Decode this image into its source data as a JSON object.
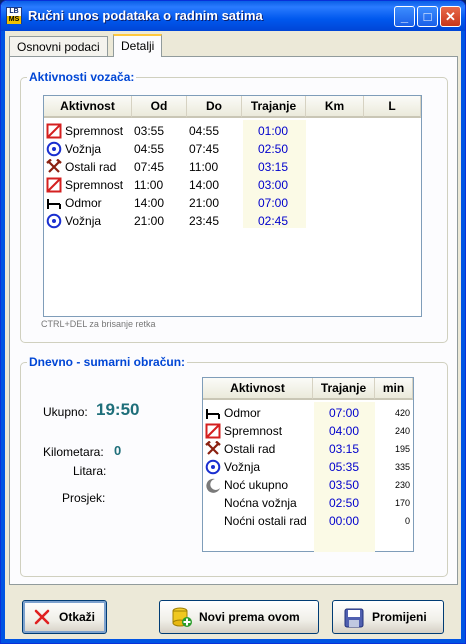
{
  "window": {
    "title": "Ručni unos podataka o radnim satima",
    "icon_text_top": "LB",
    "icon_text_bottom": "MS"
  },
  "title_buttons": {
    "minimize": "_",
    "maximize": "□",
    "close": "✕"
  },
  "tabs": [
    {
      "label": "Osnovni podaci",
      "active": false
    },
    {
      "label": "Detalji",
      "active": true
    }
  ],
  "activities_group": {
    "title": "Aktivnosti vozača:",
    "headers": [
      "Aktivnost",
      "Od",
      "Do",
      "Trajanje",
      "Km",
      "L"
    ],
    "rows": [
      {
        "icon": "spremnost-icon",
        "activity": "Spremnost",
        "from": "03:55",
        "to": "04:55",
        "duration": "01:00",
        "km": "",
        "l": ""
      },
      {
        "icon": "voznja-icon",
        "activity": "Vožnja",
        "from": "04:55",
        "to": "07:45",
        "duration": "02:50",
        "km": "",
        "l": ""
      },
      {
        "icon": "ostali-rad-icon",
        "activity": "Ostali rad",
        "from": "07:45",
        "to": "11:00",
        "duration": "03:15",
        "km": "",
        "l": ""
      },
      {
        "icon": "spremnost-icon",
        "activity": "Spremnost",
        "from": "11:00",
        "to": "14:00",
        "duration": "03:00",
        "km": "",
        "l": ""
      },
      {
        "icon": "odmor-icon",
        "activity": "Odmor",
        "from": "14:00",
        "to": "21:00",
        "duration": "07:00",
        "km": "",
        "l": ""
      },
      {
        "icon": "voznja-icon",
        "activity": "Vožnja",
        "from": "21:00",
        "to": "23:45",
        "duration": "02:45",
        "km": "",
        "l": ""
      }
    ],
    "hint": "CTRL+DEL za brisanje retka"
  },
  "summary_group": {
    "title": "Dnevno - sumarni obračun:",
    "ukupno_label": "Ukupno:",
    "ukupno_value": "19:50",
    "kilometara_label": "Kilometara:",
    "kilometara_value": "0",
    "litara_label": "Litara:",
    "prosjek_label": "Prosjek:",
    "headers": [
      "Aktivnost",
      "Trajanje",
      "min"
    ],
    "rows": [
      {
        "icon": "odmor-icon",
        "activity": "Odmor",
        "duration": "07:00",
        "min": "420"
      },
      {
        "icon": "spremnost-icon",
        "activity": "Spremnost",
        "duration": "04:00",
        "min": "240"
      },
      {
        "icon": "ostali-rad-icon",
        "activity": "Ostali rad",
        "duration": "03:15",
        "min": "195"
      },
      {
        "icon": "voznja-icon",
        "activity": "Vožnja",
        "duration": "05:35",
        "min": "335"
      },
      {
        "icon": "noc-icon",
        "activity": "Noć ukupno",
        "duration": "03:50",
        "min": "230"
      },
      {
        "icon": "",
        "activity": "Noćna vožnja",
        "duration": "02:50",
        "min": "170"
      },
      {
        "icon": "",
        "activity": "Noćni ostali rad",
        "duration": "00:00",
        "min": "0"
      }
    ]
  },
  "buttons": {
    "cancel": "Otkaži",
    "new_from": "Novi prema ovom",
    "save": "Promijeni"
  },
  "colors": {
    "accent_blue": "#0046d5",
    "value_teal": "#1f6f7a",
    "icon_red": "#d42020",
    "icon_blue": "#1a2fd0"
  }
}
